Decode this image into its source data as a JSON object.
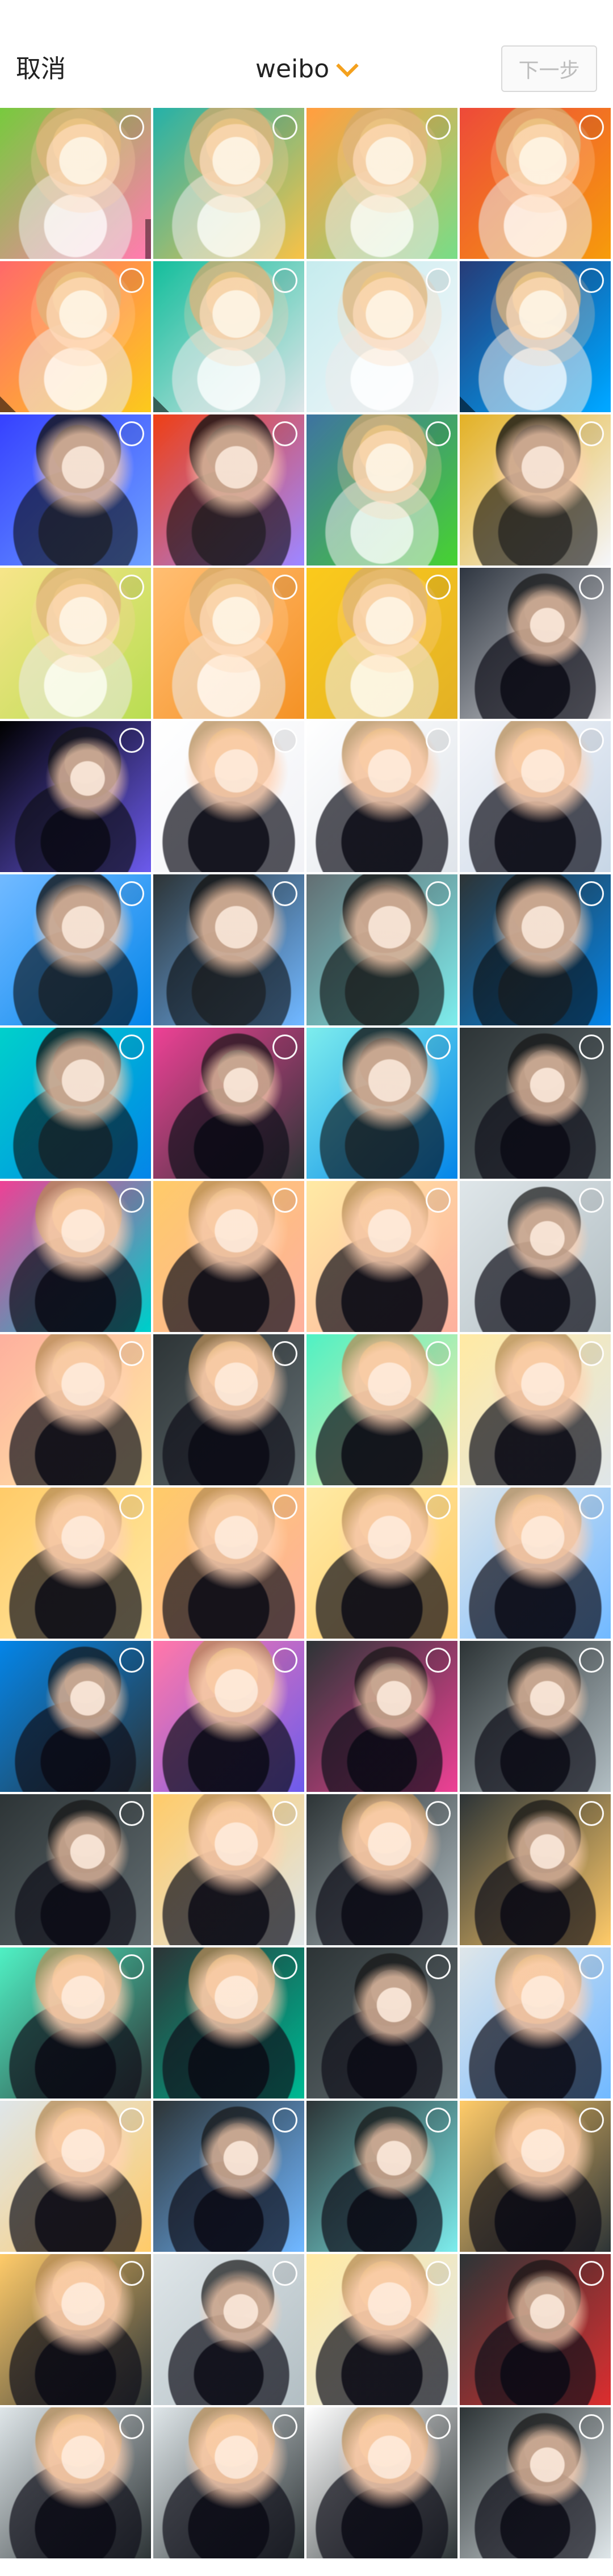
{
  "header": {
    "left_action": "取消",
    "title": "weibo",
    "right_action": "下一步"
  },
  "colors": {
    "accent": "#F4A11E",
    "text": "#222222",
    "disabled": "#BDBDBD",
    "border": "#D9D9D9"
  }
}
